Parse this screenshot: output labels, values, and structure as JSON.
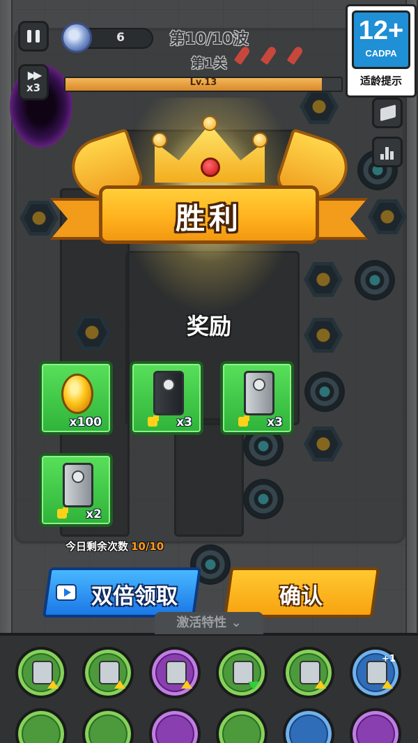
{
  "hud": {
    "gem_count": "6",
    "wave": "第10/10波",
    "level": "第1关",
    "xp_label": "Lv.13",
    "xp_progress": 0.93,
    "speed_label": "x3"
  },
  "rating_badge": {
    "age": "12+",
    "org": "CADPA",
    "hint": "适龄提示"
  },
  "victory": {
    "title": "胜利",
    "reward_heading": "奖励",
    "rewards": [
      {
        "icon": "gold-coin-icon",
        "count": "x100",
        "has_puzzle": false
      },
      {
        "icon": "cannon-part-icon",
        "count": "x3",
        "has_puzzle": true
      },
      {
        "icon": "turret-part-icon",
        "count": "x3",
        "has_puzzle": true
      },
      {
        "icon": "launcher-part-icon",
        "count": "x2",
        "has_puzzle": true
      }
    ],
    "remaining_label": "今日剩余次数",
    "remaining_value": "10/10",
    "double_button": "双倍领取",
    "confirm_button": "确认"
  },
  "toolbar": {
    "trait_tab": "激活特性",
    "skills_row1": [
      {
        "name": "skill-rocket-upgrade",
        "color": "green",
        "marker": "up"
      },
      {
        "name": "skill-crystal-upgrade",
        "color": "green",
        "marker": "up"
      },
      {
        "name": "skill-sword-upgrade",
        "color": "purple",
        "marker": "up"
      },
      {
        "name": "skill-weight-downgrade",
        "color": "green",
        "marker": "down"
      },
      {
        "name": "skill-cannon-upgrade",
        "color": "green",
        "marker": "up"
      },
      {
        "name": "skill-turret-plus-one",
        "color": "blue",
        "marker": "up",
        "badge": "+1"
      }
    ]
  },
  "colors": {
    "reward_green": "#3cc545",
    "double_blue": "#1b78e6",
    "confirm_yellow": "#f7a311",
    "remaining_orange": "#ff9b1e",
    "banner_orange": "#ffb21e"
  }
}
